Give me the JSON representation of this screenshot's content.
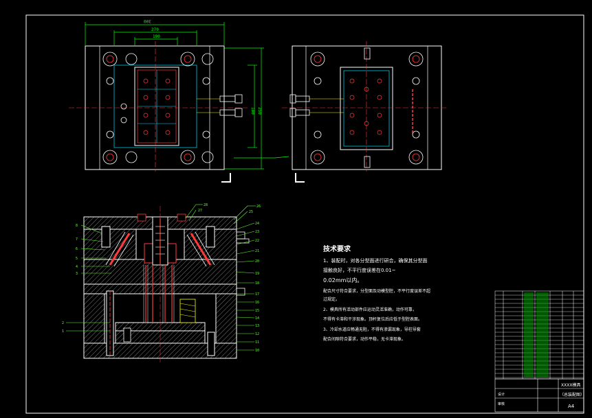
{
  "drawing": {
    "background_color": "#000000",
    "line_color": "#ffffff",
    "plate_hatch_color": "#cccccc",
    "dim_color": "#00ff00",
    "feature_color": "#ff3b3b",
    "leader_color": "#66ff33",
    "cyan_color": "#00e5ff",
    "accent_yellow": "#ffff00"
  },
  "dimensions": {
    "top_width": "300",
    "mid_width": "270",
    "inner_width": "190",
    "right_height": "250",
    "inner_height": "180"
  },
  "tech_requirements": {
    "heading": "技术要求",
    "line1": "1、装配时，对各分型面进行研合，确保其分型面",
    "line2": "接触良好，不平行度误差在0.01~",
    "line3": "0.02mm以内。",
    "line4": "配合尺寸符合要求，分型面及动模型腔，不平行度误差不超",
    "line5": "过规定。",
    "line6": "2、模具所有活动部件应运动灵活准确，动作可靠，",
    "line7": "不得有卡滞和干涉现象。顶杆复位后应低于型腔表面。",
    "line8": "3、冷却水道应畅通无阻，不得有渗漏现象，导柱导套",
    "line9": "配合间隙符合要求，动作平稳，无卡滞现象。"
  },
  "title_block": {
    "name": "XXXX模具",
    "subtitle": "（总装配图）",
    "sheet_size": "A4",
    "designer": "设计",
    "check": "审核"
  },
  "part_numbers": [
    "1",
    "2",
    "3",
    "4",
    "5",
    "6",
    "7",
    "8",
    "9",
    "10",
    "11",
    "12",
    "13",
    "14",
    "15",
    "16",
    "17",
    "18",
    "19",
    "20",
    "21",
    "22",
    "23",
    "24",
    "25",
    "26",
    "27",
    "28"
  ]
}
